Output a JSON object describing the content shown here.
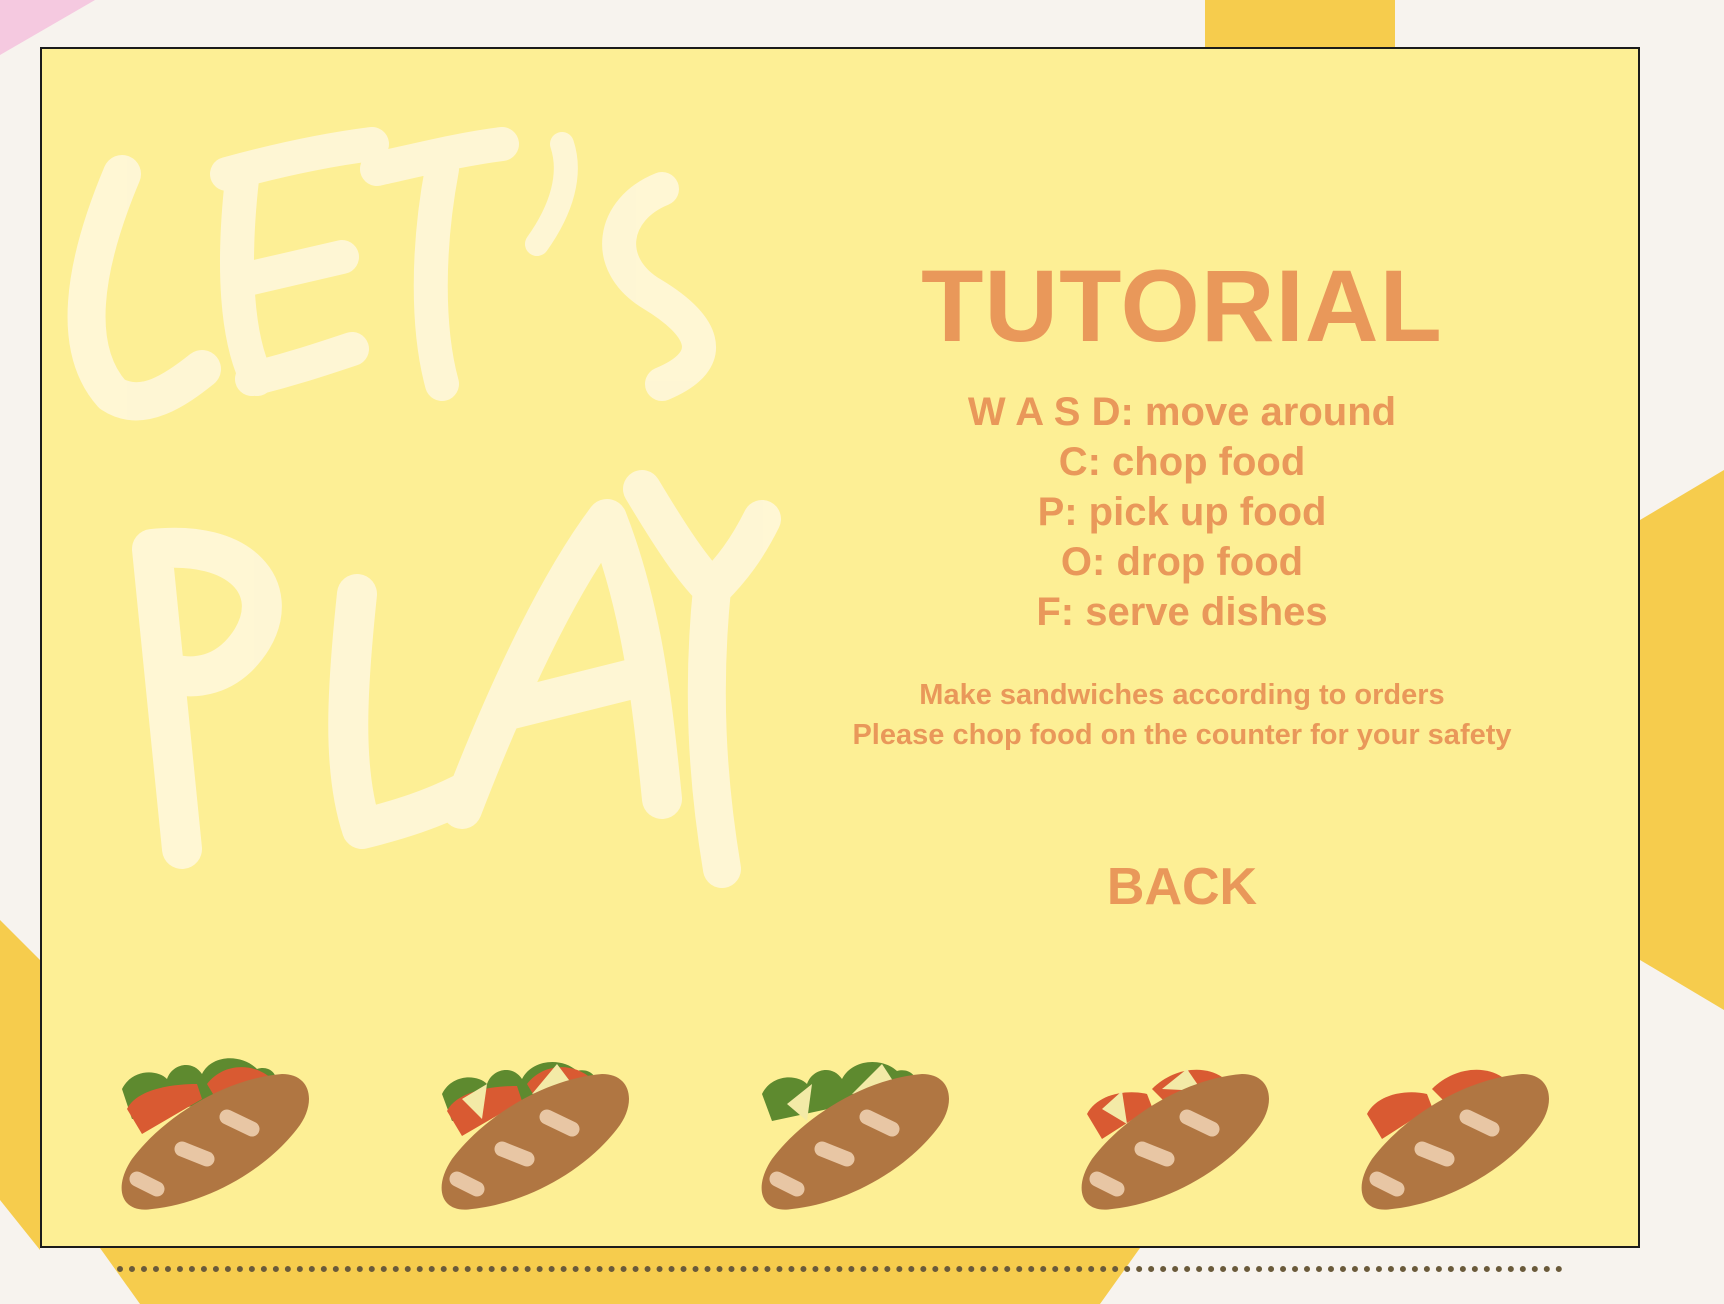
{
  "background_logo_text": "LET'S PLAY",
  "tutorial": {
    "title": "TUTORIAL",
    "controls": [
      "W A S D: move around",
      "C: chop food",
      "P: pick up food",
      "O: drop food",
      "F: serve dishes"
    ],
    "notes": [
      "Make sandwiches according to orders",
      "Please chop food on the counter for your safety"
    ],
    "back_label": "BACK"
  },
  "sandwiches": [
    {
      "name": "sandwich-lettuce-tomato-icon"
    },
    {
      "name": "sandwich-lettuce-tomato-cheese-icon"
    },
    {
      "name": "sandwich-lettuce-cheese-icon"
    },
    {
      "name": "sandwich-tomato-cheese-icon"
    },
    {
      "name": "sandwich-tomato-icon"
    }
  ],
  "colors": {
    "frame_background": "#fdef95",
    "text_accent": "#e9985a",
    "bread": "#b07642",
    "lettuce": "#5e8a2f",
    "tomato": "#d95a32",
    "cheese": "#f3eaa7"
  }
}
